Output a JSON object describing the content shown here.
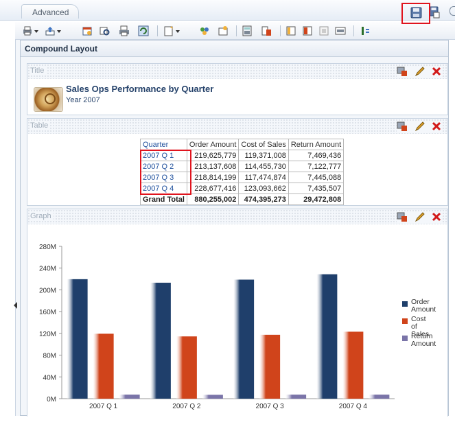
{
  "tabs": [
    {
      "label": "Advanced"
    }
  ],
  "layout_title": "Compound Layout",
  "toolbar_icons": [
    "print-icon",
    "export-icon",
    "schedule-icon",
    "preview-icon",
    "print-preview-icon",
    "refresh-icon",
    "new-view-icon",
    "filters-icon",
    "selection-steps-icon",
    "calculator-icon",
    "columns-icon",
    "sort-icon",
    "edit-icon",
    "copy-icon",
    "properties-icon",
    "toggle-icon"
  ],
  "views": {
    "title": {
      "header": "Title",
      "report_title": "Sales Ops Performance by Quarter",
      "subtitle": "Year 2007"
    },
    "table": {
      "header": "Table",
      "columns": [
        "Quarter",
        "Order Amount",
        "Cost of Sales",
        "Return Amount"
      ],
      "rows": [
        [
          "2007 Q 1",
          "219,625,779",
          "119,371,008",
          "7,469,436"
        ],
        [
          "2007 Q 2",
          "213,137,608",
          "114,455,730",
          "7,122,777"
        ],
        [
          "2007 Q 3",
          "218,814,199",
          "117,474,874",
          "7,445,088"
        ],
        [
          "2007 Q 4",
          "228,677,416",
          "123,093,662",
          "7,435,507"
        ]
      ],
      "total": [
        "Grand Total",
        "880,255,002",
        "474,395,273",
        "29,472,808"
      ]
    },
    "graph": {
      "header": "Graph",
      "legend": [
        {
          "name": "Order Amount",
          "color": "#1f3f6b"
        },
        {
          "name": "Cost of Sales",
          "color": "#d0441b"
        },
        {
          "name": "Return Amount",
          "color": "#7a74a8"
        }
      ]
    }
  },
  "chart_data": {
    "type": "bar",
    "categories": [
      "2007 Q 1",
      "2007 Q 2",
      "2007 Q 3",
      "2007 Q 4"
    ],
    "series": [
      {
        "name": "Order Amount",
        "values": [
          219625779,
          213137608,
          218814199,
          228677416
        ]
      },
      {
        "name": "Cost of Sales",
        "values": [
          119371008,
          114455730,
          117474874,
          123093662
        ]
      },
      {
        "name": "Return Amount",
        "values": [
          7469436,
          7122777,
          7445088,
          7435507
        ]
      }
    ],
    "yticks": [
      "0M",
      "40M",
      "80M",
      "120M",
      "160M",
      "200M",
      "240M",
      "280M"
    ],
    "ylim": [
      0,
      280000000
    ],
    "legend_position": "right"
  }
}
